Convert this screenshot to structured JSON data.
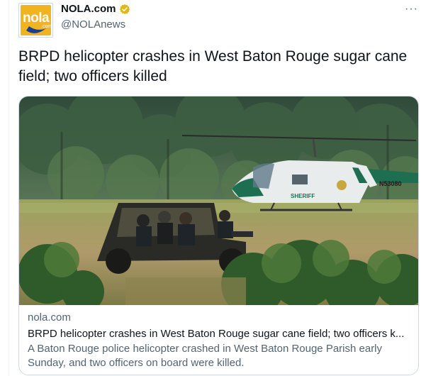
{
  "author": {
    "avatar_text": "nola",
    "avatar_sub": ".com",
    "display_name": "NOLA.com",
    "handle": "@NOLAnews",
    "verified_icon": "gold-verified-badge",
    "more_label": "···"
  },
  "tweet": {
    "text": "BRPD helicopter crashes in West Baton Rouge sugar cane field; two officers killed"
  },
  "card": {
    "domain": "nola.com",
    "title": "BRPD helicopter crashes in West Baton Rouge sugar cane field; two officers k...",
    "description": "A Baton Rouge police helicopter crashed in West Baton Rouge Parish early Sunday, and two officers on board were killed.",
    "image_alt": "Officers in a utility vehicle near a sheriff helicopter in a field",
    "helicopter_text_1": "SHERIFF",
    "helicopter_text_2": "N53080"
  },
  "colors": {
    "brand_yellow": "#f2b321",
    "verified_gold": "#e2b719",
    "text_primary": "#0f1419",
    "text_secondary": "#536471",
    "border": "#cfd9de"
  }
}
